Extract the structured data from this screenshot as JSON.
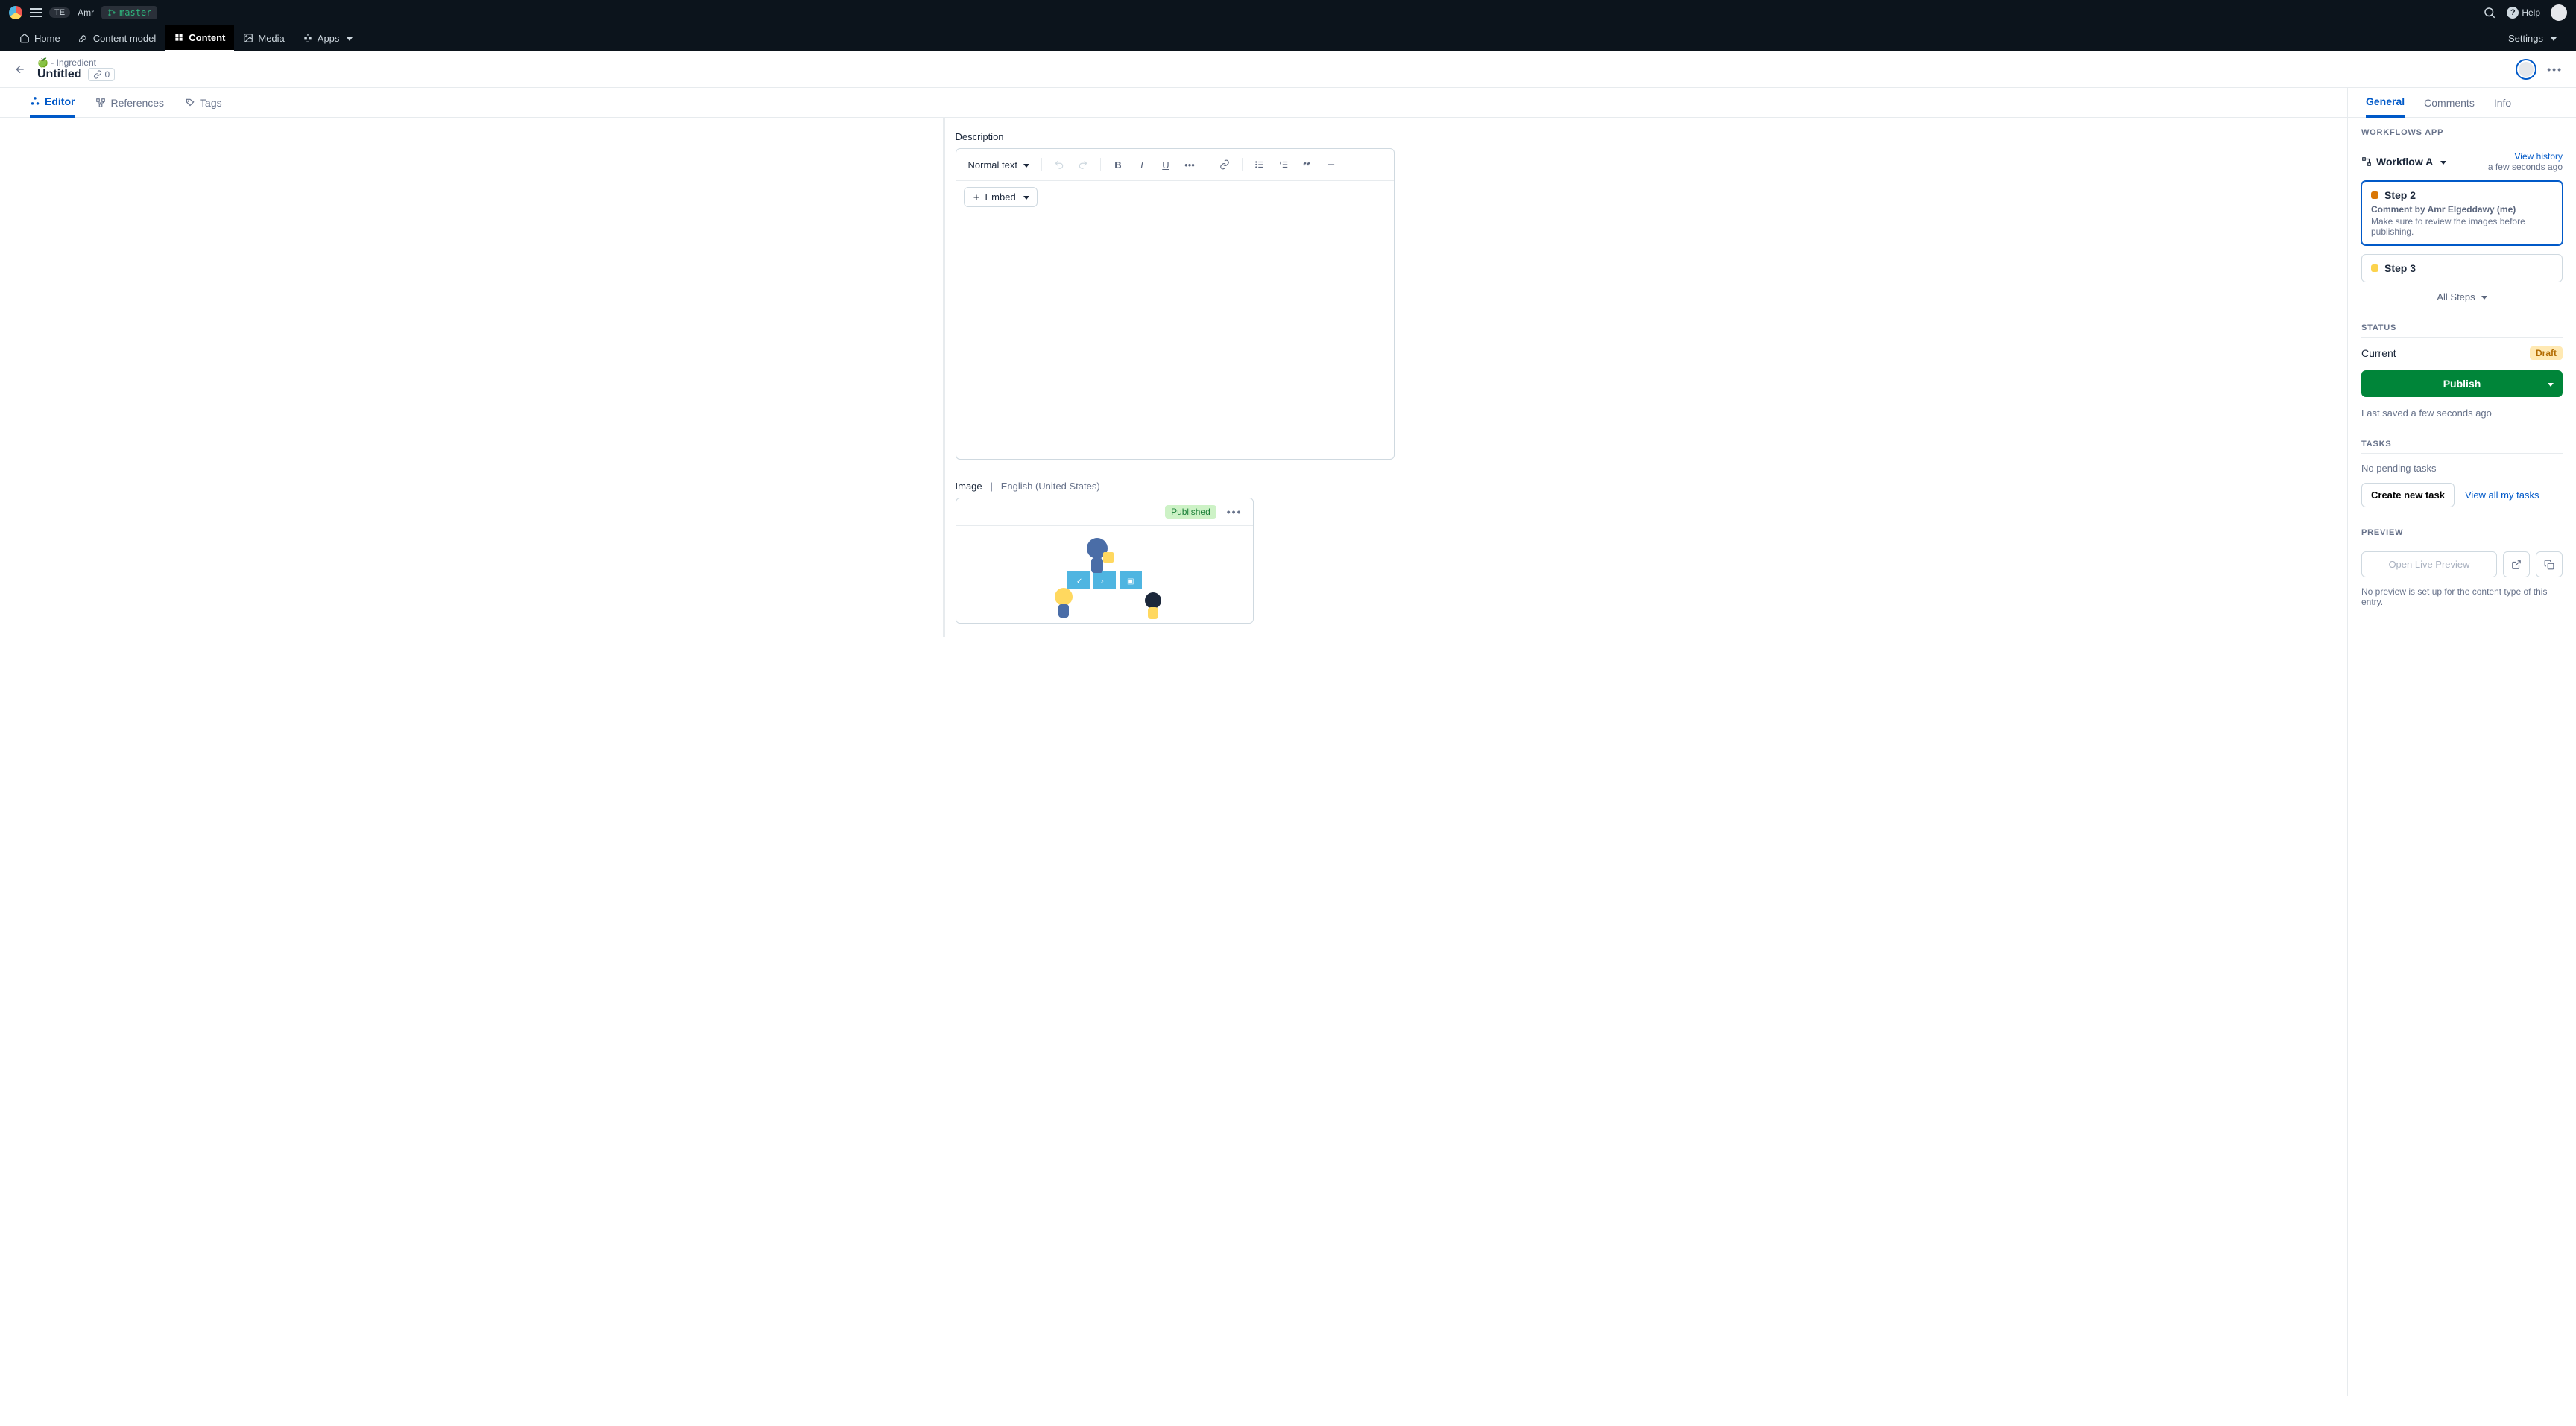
{
  "topbar": {
    "org_initials": "TE",
    "user_name": "Amr",
    "branch": "master",
    "help_label": "Help"
  },
  "nav": {
    "home": "Home",
    "content_model": "Content model",
    "content": "Content",
    "media": "Media",
    "apps": "Apps",
    "settings": "Settings"
  },
  "entry": {
    "content_type": "🍏 - Ingredient",
    "title": "Untitled",
    "link_count": "0"
  },
  "left_tabs": {
    "editor": "Editor",
    "references": "References",
    "tags": "Tags"
  },
  "right_tabs": {
    "general": "General",
    "comments": "Comments",
    "info": "Info"
  },
  "editor": {
    "description_label": "Description",
    "style_selector": "Normal text",
    "embed_label": "Embed",
    "image_label": "Image",
    "image_locale": "English (United States)",
    "image_status": "Published"
  },
  "workflows": {
    "section_title": "WORKFLOWS APP",
    "workflow_name": "Workflow A",
    "view_history": "View history",
    "history_time": "a few seconds ago",
    "steps": [
      {
        "name": "Step 2",
        "color": "#d97706",
        "comment_by": "Comment by Amr Elgeddawy (me)",
        "comment": "Make sure to review the images before publishing.",
        "active": true
      },
      {
        "name": "Step 3",
        "color": "#fcd34d",
        "active": false
      }
    ],
    "all_steps": "All Steps"
  },
  "status": {
    "section_title": "STATUS",
    "current_label": "Current",
    "badge": "Draft",
    "publish_label": "Publish",
    "last_saved": "Last saved a few seconds ago"
  },
  "tasks": {
    "section_title": "TASKS",
    "empty": "No pending tasks",
    "create_label": "Create new task",
    "view_all_label": "View all my tasks"
  },
  "preview": {
    "section_title": "PREVIEW",
    "open_label": "Open Live Preview",
    "note": "No preview is set up for the content type of this entry."
  }
}
